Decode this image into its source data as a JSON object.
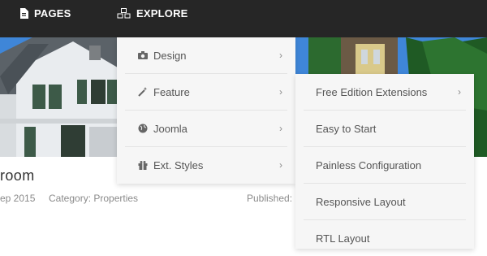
{
  "topnav": {
    "pages_label": "PAGES",
    "explore_label": "EXPLORE"
  },
  "article": {
    "title_fragment": "room",
    "date_fragment": "ep 2015",
    "category": "Category: Properties",
    "published": "Published:"
  },
  "explore_menu": {
    "items": [
      {
        "label": "Design",
        "icon": "camera-icon"
      },
      {
        "label": "Feature",
        "icon": "magic-wand-icon"
      },
      {
        "label": "Joomla",
        "icon": "globe-icon"
      },
      {
        "label": "Ext. Styles",
        "icon": "gift-icon"
      }
    ]
  },
  "feature_submenu": {
    "items": [
      {
        "label": "Free Edition Extensions"
      },
      {
        "label": "Easy to Start"
      },
      {
        "label": "Painless Configuration"
      },
      {
        "label": "Responsive Layout"
      },
      {
        "label": "RTL Layout"
      }
    ]
  },
  "colors": {
    "topbar": "#262626",
    "menu_bg": "#f6f6f6",
    "menu_text": "#555555",
    "meta_text": "#8a8a8a"
  }
}
